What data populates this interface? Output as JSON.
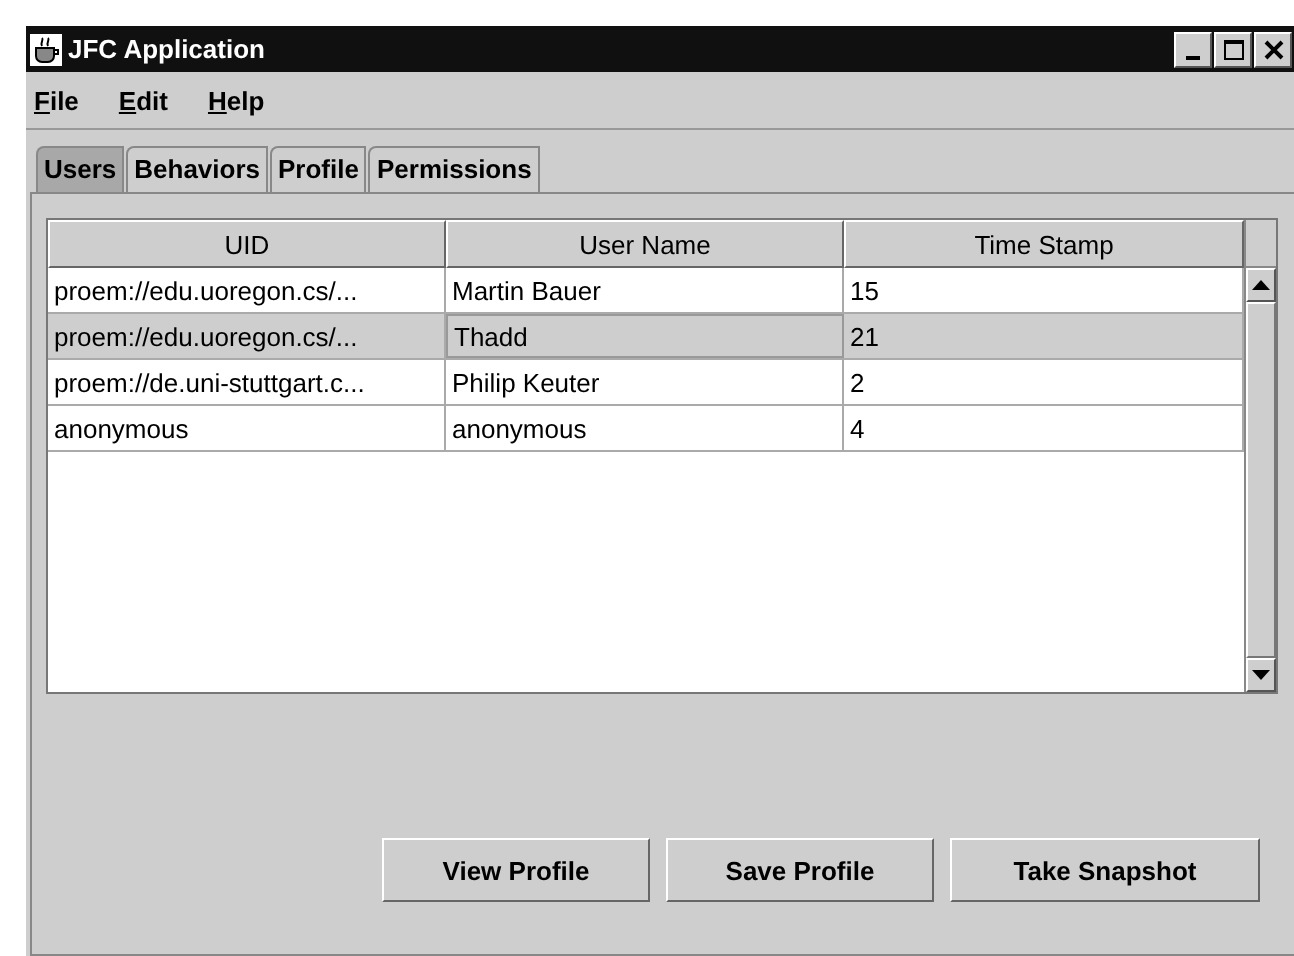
{
  "window": {
    "title": "JFC Application"
  },
  "menu": [
    "File",
    "Edit",
    "Help"
  ],
  "tabs": [
    {
      "label": "Users",
      "selected": true
    },
    {
      "label": "Behaviors",
      "selected": false
    },
    {
      "label": "Profile",
      "selected": false
    },
    {
      "label": "Permissions",
      "selected": false
    }
  ],
  "table": {
    "columns": [
      "UID",
      "User Name",
      "Time Stamp"
    ],
    "rows": [
      {
        "cells": [
          "proem://edu.uoregon.cs/...",
          "Martin Bauer",
          "15"
        ],
        "selected": false
      },
      {
        "cells": [
          "proem://edu.uoregon.cs/...",
          "Thadd",
          "21"
        ],
        "selected": true
      },
      {
        "cells": [
          "proem://de.uni-stuttgart.c...",
          "Philip Keuter",
          "2"
        ],
        "selected": false
      },
      {
        "cells": [
          "anonymous",
          "anonymous",
          "4"
        ],
        "selected": false
      }
    ]
  },
  "buttons": [
    "View Profile",
    "Save Profile",
    "Take Snapshot"
  ]
}
